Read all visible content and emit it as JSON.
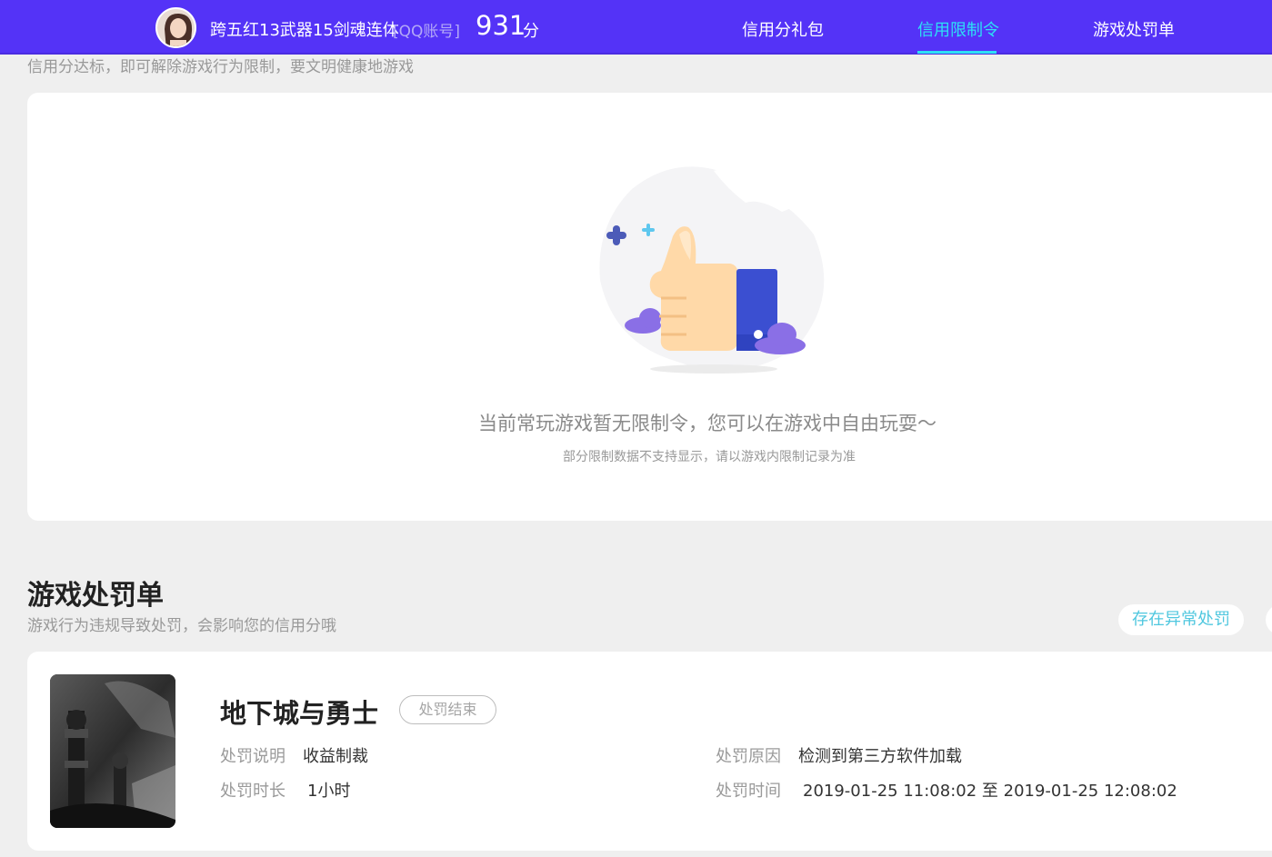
{
  "header": {
    "username": "跨五红13武器15剑魂连体",
    "account_type": "[QQ账号]",
    "score": "931",
    "score_unit": "分",
    "tabs": [
      {
        "label": "信用分礼包",
        "active": false
      },
      {
        "label": "信用限制令",
        "active": true
      },
      {
        "label": "游戏处罚单",
        "active": false
      }
    ],
    "accent_color": "#5433f7",
    "active_color": "#2de0f5"
  },
  "restriction": {
    "note": "信用分达标，即可解除游戏行为限制，要文明健康地游戏",
    "empty_title": "当前常玩游戏暂无限制令，您可以在游戏中自由玩耍～",
    "empty_subtitle": "部分限制数据不支持显示，请以游戏内限制记录为准",
    "illustration": "thumbs-up-icon"
  },
  "penalty": {
    "title": "游戏处罚单",
    "description": "游戏行为违规导致处罚，会影响您的信用分哦",
    "filter_button": "存在异常处罚",
    "record": {
      "game": "地下城与勇士",
      "status": "处罚结束",
      "desc_label": "处罚说明",
      "desc_value": "收益制裁",
      "reason_label": "处罚原因",
      "reason_value": "检测到第三方软件加载",
      "duration_label": "处罚时长",
      "duration_value": "1小时",
      "time_label": "处罚时间",
      "time_value": "2019-01-25 11:08:02 至 2019-01-25 12:08:02"
    }
  }
}
